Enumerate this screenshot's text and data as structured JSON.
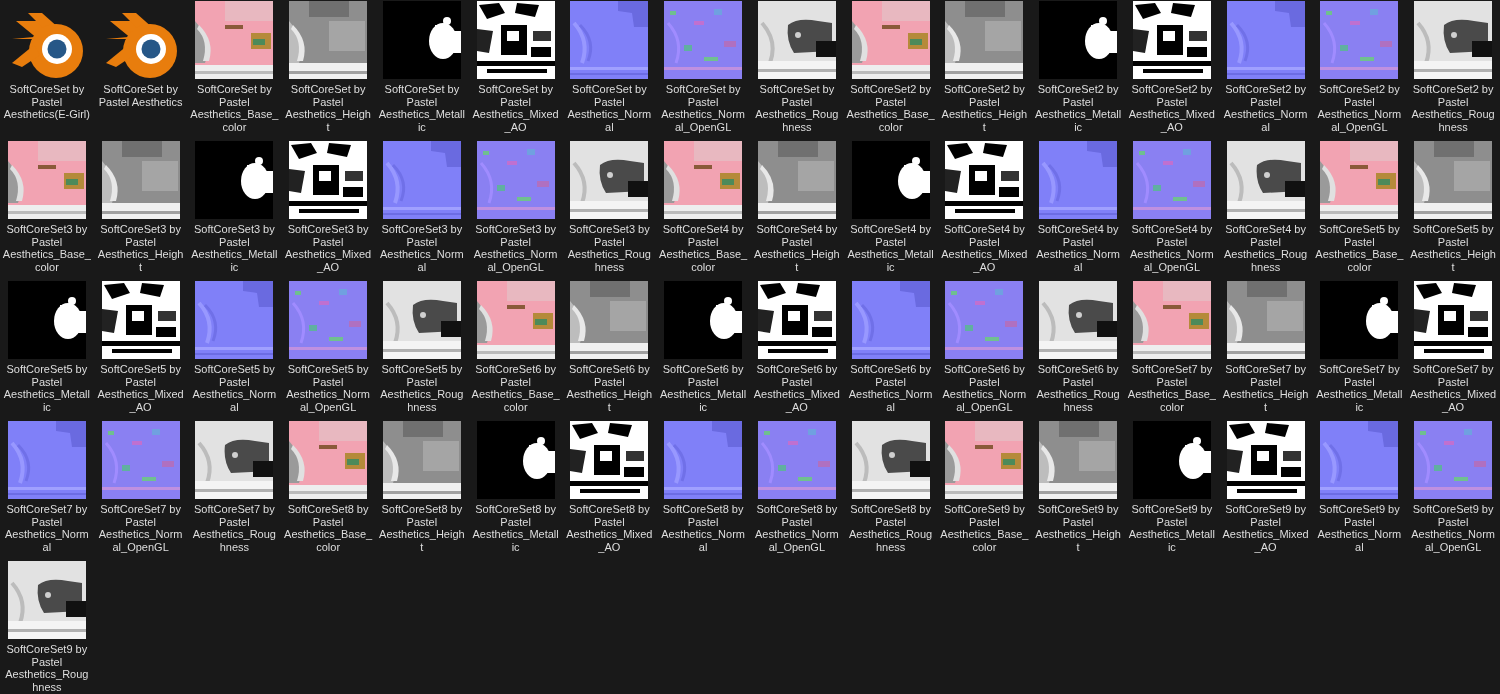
{
  "files": [
    {
      "kind": "blend",
      "name_lines": [
        "SoftCoreSet by",
        "Pastel",
        "Aesthetics(E-Girl)"
      ]
    },
    {
      "kind": "blend",
      "name_lines": [
        "SoftCoreSet by",
        "Pastel Aesthetics"
      ]
    },
    {
      "kind": "base_color",
      "name_lines": [
        "SoftCoreSet by",
        "Pastel",
        "Aesthetics_Base_",
        "color"
      ]
    },
    {
      "kind": "height",
      "name_lines": [
        "SoftCoreSet by",
        "Pastel",
        "Aesthetics_Heigh",
        "t"
      ]
    },
    {
      "kind": "metallic",
      "name_lines": [
        "SoftCoreSet by",
        "Pastel",
        "Aesthetics_Metall",
        "ic"
      ]
    },
    {
      "kind": "mixed_ao",
      "name_lines": [
        "SoftCoreSet by",
        "Pastel",
        "Aesthetics_Mixed",
        "_AO"
      ]
    },
    {
      "kind": "normal",
      "name_lines": [
        "SoftCoreSet by",
        "Pastel",
        "Aesthetics_Norm",
        "al"
      ]
    },
    {
      "kind": "normal_opengl",
      "name_lines": [
        "SoftCoreSet by",
        "Pastel",
        "Aesthetics_Norm",
        "al_OpenGL"
      ]
    },
    {
      "kind": "roughness",
      "name_lines": [
        "SoftCoreSet by",
        "Pastel",
        "Aesthetics_Roug",
        "hness"
      ]
    },
    {
      "kind": "base_color",
      "name_lines": [
        "SoftCoreSet2 by",
        "Pastel",
        "Aesthetics_Base_",
        "color"
      ]
    },
    {
      "kind": "height",
      "name_lines": [
        "SoftCoreSet2 by",
        "Pastel",
        "Aesthetics_Heigh",
        "t"
      ]
    },
    {
      "kind": "metallic",
      "name_lines": [
        "SoftCoreSet2 by",
        "Pastel",
        "Aesthetics_Metall",
        "ic"
      ]
    },
    {
      "kind": "mixed_ao",
      "name_lines": [
        "SoftCoreSet2 by",
        "Pastel",
        "Aesthetics_Mixed",
        "_AO"
      ]
    },
    {
      "kind": "normal",
      "name_lines": [
        "SoftCoreSet2 by",
        "Pastel",
        "Aesthetics_Norm",
        "al"
      ]
    },
    {
      "kind": "normal_opengl",
      "name_lines": [
        "SoftCoreSet2 by",
        "Pastel",
        "Aesthetics_Norm",
        "al_OpenGL"
      ]
    },
    {
      "kind": "roughness",
      "name_lines": [
        "SoftCoreSet2 by",
        "Pastel",
        "Aesthetics_Roug",
        "hness"
      ]
    },
    {
      "kind": "base_color",
      "name_lines": [
        "SoftCoreSet3 by",
        "Pastel",
        "Aesthetics_Base_",
        "color"
      ]
    },
    {
      "kind": "height",
      "name_lines": [
        "SoftCoreSet3 by",
        "Pastel",
        "Aesthetics_Heigh",
        "t"
      ]
    },
    {
      "kind": "metallic",
      "name_lines": [
        "SoftCoreSet3 by",
        "Pastel",
        "Aesthetics_Metall",
        "ic"
      ]
    },
    {
      "kind": "mixed_ao",
      "name_lines": [
        "SoftCoreSet3 by",
        "Pastel",
        "Aesthetics_Mixed",
        "_AO"
      ]
    },
    {
      "kind": "normal",
      "name_lines": [
        "SoftCoreSet3 by",
        "Pastel",
        "Aesthetics_Norm",
        "al"
      ]
    },
    {
      "kind": "normal_opengl",
      "name_lines": [
        "SoftCoreSet3 by",
        "Pastel",
        "Aesthetics_Norm",
        "al_OpenGL"
      ]
    },
    {
      "kind": "roughness",
      "name_lines": [
        "SoftCoreSet3 by",
        "Pastel",
        "Aesthetics_Roug",
        "hness"
      ]
    },
    {
      "kind": "base_color",
      "name_lines": [
        "SoftCoreSet4 by",
        "Pastel",
        "Aesthetics_Base_",
        "color"
      ]
    },
    {
      "kind": "height",
      "name_lines": [
        "SoftCoreSet4 by",
        "Pastel",
        "Aesthetics_Heigh",
        "t"
      ]
    },
    {
      "kind": "metallic",
      "name_lines": [
        "SoftCoreSet4 by",
        "Pastel",
        "Aesthetics_Metall",
        "ic"
      ]
    },
    {
      "kind": "mixed_ao",
      "name_lines": [
        "SoftCoreSet4 by",
        "Pastel",
        "Aesthetics_Mixed",
        "_AO"
      ]
    },
    {
      "kind": "normal",
      "name_lines": [
        "SoftCoreSet4 by",
        "Pastel",
        "Aesthetics_Norm",
        "al"
      ]
    },
    {
      "kind": "normal_opengl",
      "name_lines": [
        "SoftCoreSet4 by",
        "Pastel",
        "Aesthetics_Norm",
        "al_OpenGL"
      ]
    },
    {
      "kind": "roughness",
      "name_lines": [
        "SoftCoreSet4 by",
        "Pastel",
        "Aesthetics_Roug",
        "hness"
      ]
    },
    {
      "kind": "base_color",
      "name_lines": [
        "SoftCoreSet5 by",
        "Pastel",
        "Aesthetics_Base_",
        "color"
      ]
    },
    {
      "kind": "height",
      "name_lines": [
        "SoftCoreSet5 by",
        "Pastel",
        "Aesthetics_Heigh",
        "t"
      ]
    },
    {
      "kind": "metallic",
      "name_lines": [
        "SoftCoreSet5 by",
        "Pastel",
        "Aesthetics_Metall",
        "ic"
      ]
    },
    {
      "kind": "mixed_ao",
      "name_lines": [
        "SoftCoreSet5 by",
        "Pastel",
        "Aesthetics_Mixed",
        "_AO"
      ]
    },
    {
      "kind": "normal",
      "name_lines": [
        "SoftCoreSet5 by",
        "Pastel",
        "Aesthetics_Norm",
        "al"
      ]
    },
    {
      "kind": "normal_opengl",
      "name_lines": [
        "SoftCoreSet5 by",
        "Pastel",
        "Aesthetics_Norm",
        "al_OpenGL"
      ]
    },
    {
      "kind": "roughness",
      "name_lines": [
        "SoftCoreSet5 by",
        "Pastel",
        "Aesthetics_Roug",
        "hness"
      ]
    },
    {
      "kind": "base_color",
      "name_lines": [
        "SoftCoreSet6 by",
        "Pastel",
        "Aesthetics_Base_",
        "color"
      ]
    },
    {
      "kind": "height",
      "name_lines": [
        "SoftCoreSet6 by",
        "Pastel",
        "Aesthetics_Heigh",
        "t"
      ]
    },
    {
      "kind": "metallic",
      "name_lines": [
        "SoftCoreSet6 by",
        "Pastel",
        "Aesthetics_Metall",
        "ic"
      ]
    },
    {
      "kind": "mixed_ao",
      "name_lines": [
        "SoftCoreSet6 by",
        "Pastel",
        "Aesthetics_Mixed",
        "_AO"
      ]
    },
    {
      "kind": "normal",
      "name_lines": [
        "SoftCoreSet6 by",
        "Pastel",
        "Aesthetics_Norm",
        "al"
      ]
    },
    {
      "kind": "normal_opengl",
      "name_lines": [
        "SoftCoreSet6 by",
        "Pastel",
        "Aesthetics_Norm",
        "al_OpenGL"
      ]
    },
    {
      "kind": "roughness",
      "name_lines": [
        "SoftCoreSet6 by",
        "Pastel",
        "Aesthetics_Roug",
        "hness"
      ]
    },
    {
      "kind": "base_color",
      "name_lines": [
        "SoftCoreSet7 by",
        "Pastel",
        "Aesthetics_Base_",
        "color"
      ]
    },
    {
      "kind": "height",
      "name_lines": [
        "SoftCoreSet7 by",
        "Pastel",
        "Aesthetics_Heigh",
        "t"
      ]
    },
    {
      "kind": "metallic",
      "name_lines": [
        "SoftCoreSet7 by",
        "Pastel",
        "Aesthetics_Metall",
        "ic"
      ]
    },
    {
      "kind": "mixed_ao",
      "name_lines": [
        "SoftCoreSet7 by",
        "Pastel",
        "Aesthetics_Mixed",
        "_AO"
      ]
    },
    {
      "kind": "normal",
      "name_lines": [
        "SoftCoreSet7 by",
        "Pastel",
        "Aesthetics_Norm",
        "al"
      ]
    },
    {
      "kind": "normal_opengl",
      "name_lines": [
        "SoftCoreSet7 by",
        "Pastel",
        "Aesthetics_Norm",
        "al_OpenGL"
      ]
    },
    {
      "kind": "roughness",
      "name_lines": [
        "SoftCoreSet7 by",
        "Pastel",
        "Aesthetics_Roug",
        "hness"
      ]
    },
    {
      "kind": "base_color",
      "name_lines": [
        "SoftCoreSet8 by",
        "Pastel",
        "Aesthetics_Base_",
        "color"
      ]
    },
    {
      "kind": "height",
      "name_lines": [
        "SoftCoreSet8 by",
        "Pastel",
        "Aesthetics_Heigh",
        "t"
      ]
    },
    {
      "kind": "metallic",
      "name_lines": [
        "SoftCoreSet8 by",
        "Pastel",
        "Aesthetics_Metall",
        "ic"
      ]
    },
    {
      "kind": "mixed_ao",
      "name_lines": [
        "SoftCoreSet8 by",
        "Pastel",
        "Aesthetics_Mixed",
        "_AO"
      ]
    },
    {
      "kind": "normal",
      "name_lines": [
        "SoftCoreSet8 by",
        "Pastel",
        "Aesthetics_Norm",
        "al"
      ]
    },
    {
      "kind": "normal_opengl",
      "name_lines": [
        "SoftCoreSet8 by",
        "Pastel",
        "Aesthetics_Norm",
        "al_OpenGL"
      ]
    },
    {
      "kind": "roughness",
      "name_lines": [
        "SoftCoreSet8 by",
        "Pastel",
        "Aesthetics_Roug",
        "hness"
      ]
    },
    {
      "kind": "base_color",
      "name_lines": [
        "SoftCoreSet9 by",
        "Pastel",
        "Aesthetics_Base_",
        "color"
      ]
    },
    {
      "kind": "height",
      "name_lines": [
        "SoftCoreSet9 by",
        "Pastel",
        "Aesthetics_Heigh",
        "t"
      ]
    },
    {
      "kind": "metallic",
      "name_lines": [
        "SoftCoreSet9 by",
        "Pastel",
        "Aesthetics_Metall",
        "ic"
      ]
    },
    {
      "kind": "mixed_ao",
      "name_lines": [
        "SoftCoreSet9 by",
        "Pastel",
        "Aesthetics_Mixed",
        "_AO"
      ]
    },
    {
      "kind": "normal",
      "name_lines": [
        "SoftCoreSet9 by",
        "Pastel",
        "Aesthetics_Norm",
        "al"
      ]
    },
    {
      "kind": "normal_opengl",
      "name_lines": [
        "SoftCoreSet9 by",
        "Pastel",
        "Aesthetics_Norm",
        "al_OpenGL"
      ]
    },
    {
      "kind": "roughness",
      "name_lines": [
        "SoftCoreSet9 by",
        "Pastel",
        "Aesthetics_Roug",
        "hness"
      ]
    }
  ]
}
